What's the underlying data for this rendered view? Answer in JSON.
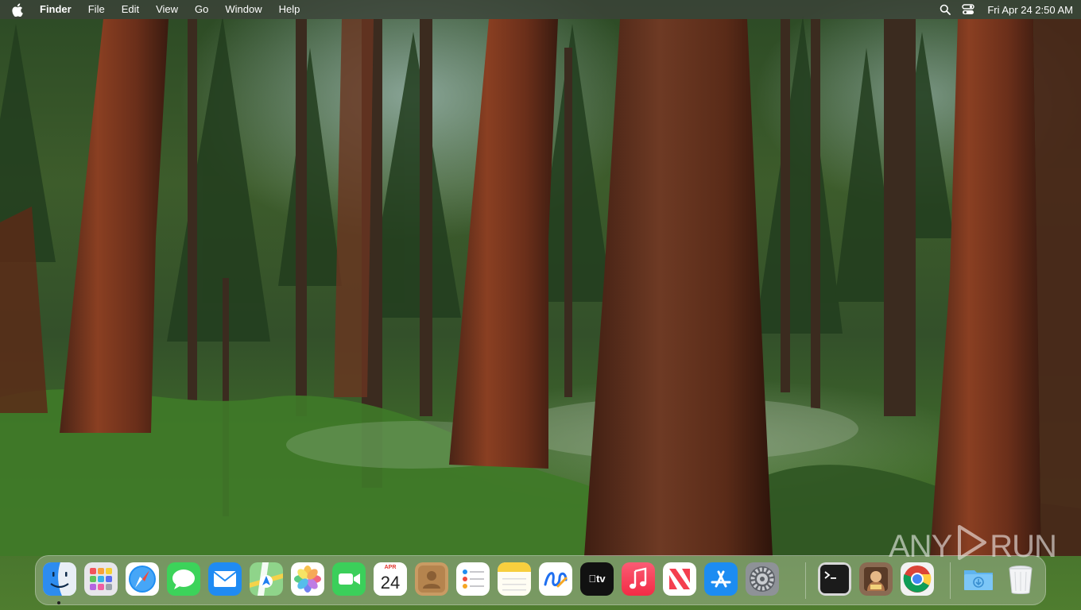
{
  "menubar": {
    "apple_icon": "apple-logo-icon",
    "app_name": "Finder",
    "menus": [
      "File",
      "Edit",
      "View",
      "Go",
      "Window",
      "Help"
    ],
    "status_icons": [
      "search-icon",
      "control-center-icon"
    ],
    "clock": "Fri Apr 24  2:50 AM"
  },
  "dock": {
    "apps": [
      {
        "name": "Finder",
        "icon": "finder-icon",
        "running": true
      },
      {
        "name": "Launchpad",
        "icon": "launchpad-icon"
      },
      {
        "name": "Safari",
        "icon": "safari-icon"
      },
      {
        "name": "Messages",
        "icon": "messages-icon"
      },
      {
        "name": "Mail",
        "icon": "mail-icon"
      },
      {
        "name": "Maps",
        "icon": "maps-icon"
      },
      {
        "name": "Photos",
        "icon": "photos-icon"
      },
      {
        "name": "FaceTime",
        "icon": "facetime-icon"
      },
      {
        "name": "Calendar",
        "icon": "calendar-icon",
        "month": "APR",
        "day": "24"
      },
      {
        "name": "Contacts",
        "icon": "contacts-icon"
      },
      {
        "name": "Reminders",
        "icon": "reminders-icon"
      },
      {
        "name": "Notes",
        "icon": "notes-icon"
      },
      {
        "name": "Freeform",
        "icon": "freeform-icon"
      },
      {
        "name": "TV",
        "icon": "tv-icon",
        "label": "tv"
      },
      {
        "name": "Music",
        "icon": "music-icon"
      },
      {
        "name": "News",
        "icon": "news-icon"
      },
      {
        "name": "App Store",
        "icon": "app-store-icon"
      },
      {
        "name": "System Settings",
        "icon": "settings-gear-icon"
      },
      {
        "name": "Terminal",
        "icon": "terminal-icon"
      },
      {
        "name": "Image Viewer",
        "icon": "image-app-icon"
      },
      {
        "name": "Google Chrome",
        "icon": "chrome-icon"
      },
      {
        "name": "Downloads",
        "icon": "downloads-folder-icon"
      },
      {
        "name": "Trash",
        "icon": "trash-icon"
      }
    ]
  },
  "watermark": {
    "left": "ANY",
    "right": "RUN"
  },
  "colors": {
    "menubar_bg": "#3c423a",
    "dock_bg": "#cdd2c8",
    "accent_blue": "#1a8cff"
  }
}
